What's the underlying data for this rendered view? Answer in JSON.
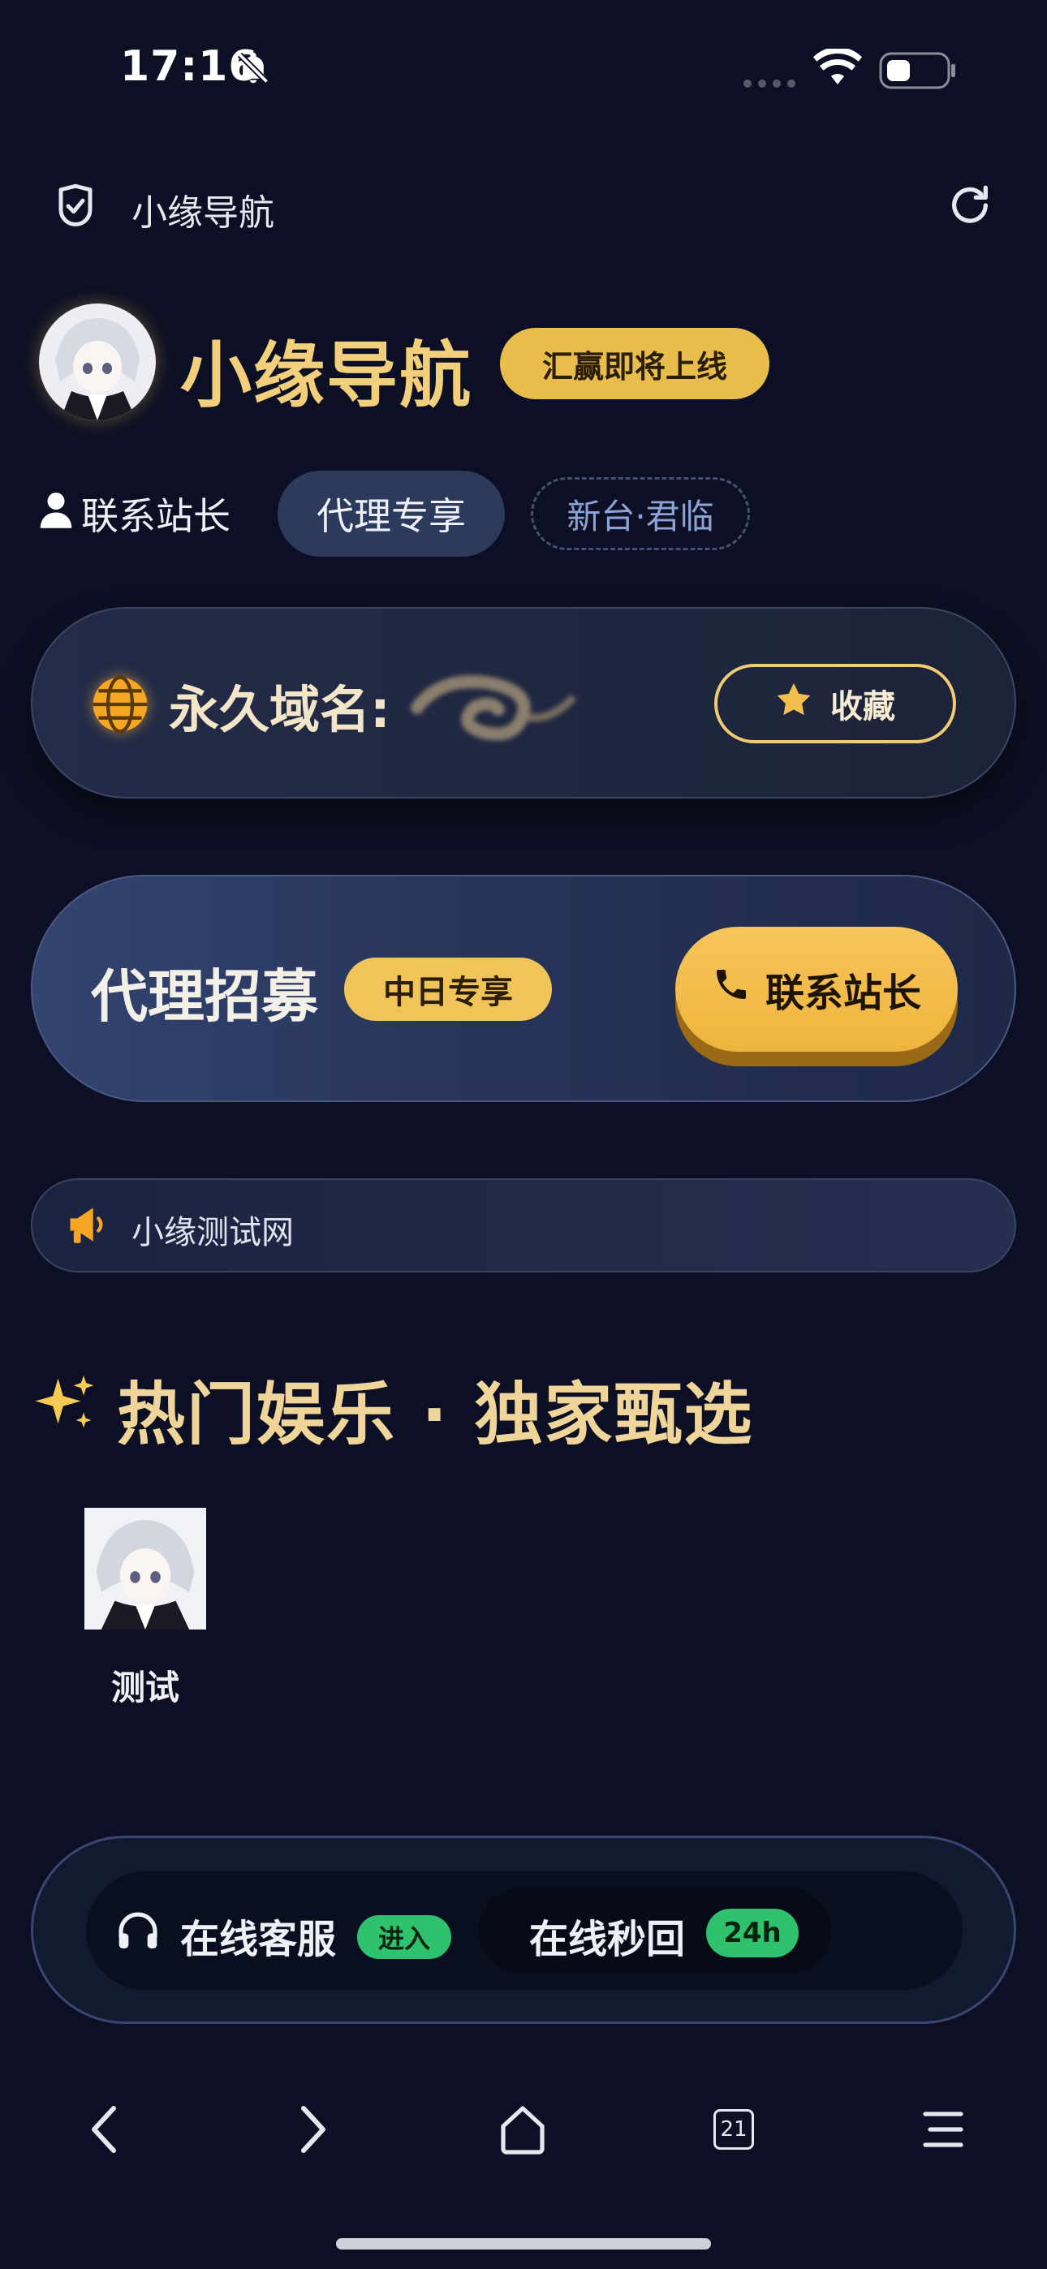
{
  "status_bar": {
    "time": "17:16"
  },
  "nav": {
    "title": "小缘导航"
  },
  "header": {
    "site_title": "小缘导航",
    "badge": "汇赢即将上线"
  },
  "pills": {
    "contact": "联系站长",
    "agent": "代理专享",
    "new_site": "新台·君临"
  },
  "domain_card": {
    "label": "永久域名:",
    "favorite_button": "收藏"
  },
  "recruit_card": {
    "title": "代理招募",
    "badge": "中日专享",
    "contact_button": "联系站长"
  },
  "notice": {
    "text": "小缘测试网"
  },
  "section": {
    "title": "热门娱乐 · 独家甄选"
  },
  "apps": [
    {
      "label": "测试"
    }
  ],
  "support": {
    "cs_label": "在线客服",
    "cs_enter": "进入",
    "reply_label": "在线秒回",
    "reply_badge": "24h"
  },
  "browser": {
    "tabs_count": "21"
  },
  "colors": {
    "background": "#0d1024",
    "gold": "#f2cf7a",
    "accent_green": "#2ec16e"
  }
}
